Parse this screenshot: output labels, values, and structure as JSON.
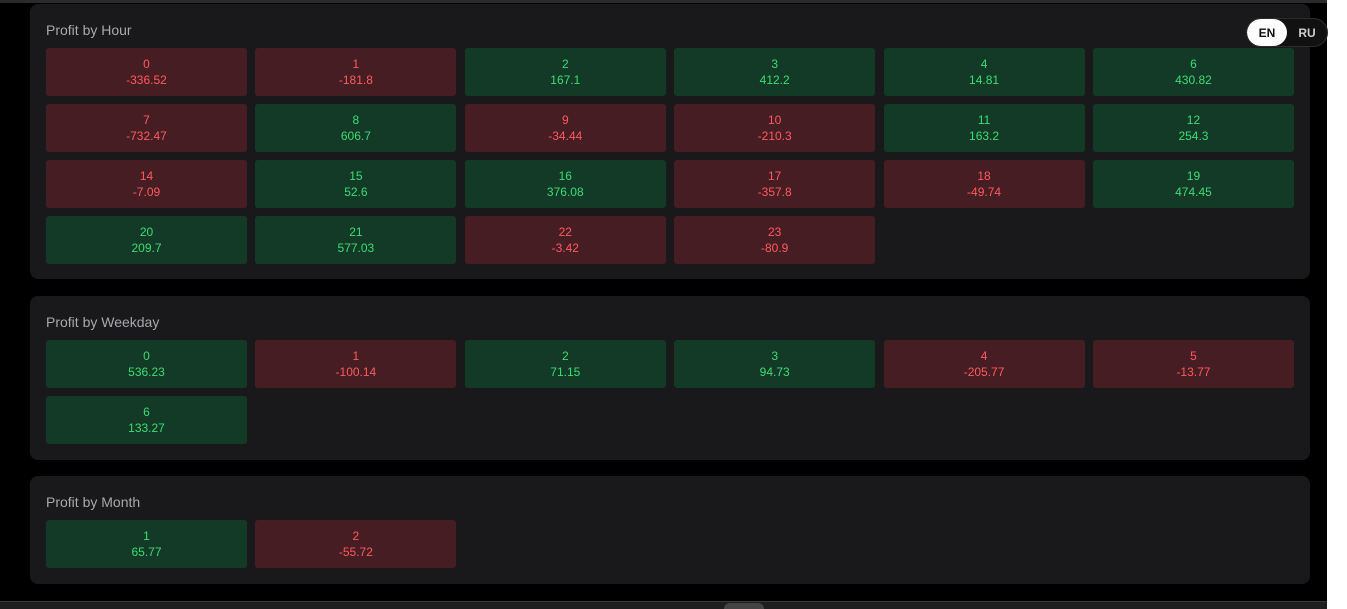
{
  "language_toggle": {
    "options": [
      {
        "label": "EN",
        "active": true
      },
      {
        "label": "RU",
        "active": false
      }
    ]
  },
  "sections": [
    {
      "title": "Profit by Hour",
      "cells": [
        {
          "key": "0",
          "value": "-336.52"
        },
        {
          "key": "1",
          "value": "-181.8"
        },
        {
          "key": "2",
          "value": "167.1"
        },
        {
          "key": "3",
          "value": "412.2"
        },
        {
          "key": "4",
          "value": "14.81"
        },
        {
          "key": "6",
          "value": "430.82"
        },
        {
          "key": "7",
          "value": "-732.47"
        },
        {
          "key": "8",
          "value": "606.7"
        },
        {
          "key": "9",
          "value": "-34.44"
        },
        {
          "key": "10",
          "value": "-210.3"
        },
        {
          "key": "11",
          "value": "163.2"
        },
        {
          "key": "12",
          "value": "254.3"
        },
        {
          "key": "14",
          "value": "-7.09"
        },
        {
          "key": "15",
          "value": "52.6"
        },
        {
          "key": "16",
          "value": "376.08"
        },
        {
          "key": "17",
          "value": "-357.8"
        },
        {
          "key": "18",
          "value": "-49.74"
        },
        {
          "key": "19",
          "value": "474.45"
        },
        {
          "key": "20",
          "value": "209.7"
        },
        {
          "key": "21",
          "value": "577.03"
        },
        {
          "key": "22",
          "value": "-3.42"
        },
        {
          "key": "23",
          "value": "-80.9"
        }
      ]
    },
    {
      "title": "Profit by Weekday",
      "cells": [
        {
          "key": "0",
          "value": "536.23"
        },
        {
          "key": "1",
          "value": "-100.14"
        },
        {
          "key": "2",
          "value": "71.15"
        },
        {
          "key": "3",
          "value": "94.73"
        },
        {
          "key": "4",
          "value": "-205.77"
        },
        {
          "key": "5",
          "value": "-13.77"
        },
        {
          "key": "6",
          "value": "133.27"
        }
      ]
    },
    {
      "title": "Profit by Month",
      "cells": [
        {
          "key": "1",
          "value": "65.77"
        },
        {
          "key": "2",
          "value": "-55.72"
        }
      ]
    }
  ],
  "colors": {
    "positive_bg": "#133a27",
    "positive_text": "#3ddc74",
    "negative_bg": "#461d22",
    "negative_text": "#ff5a5f",
    "panel_bg": "#19191b"
  }
}
